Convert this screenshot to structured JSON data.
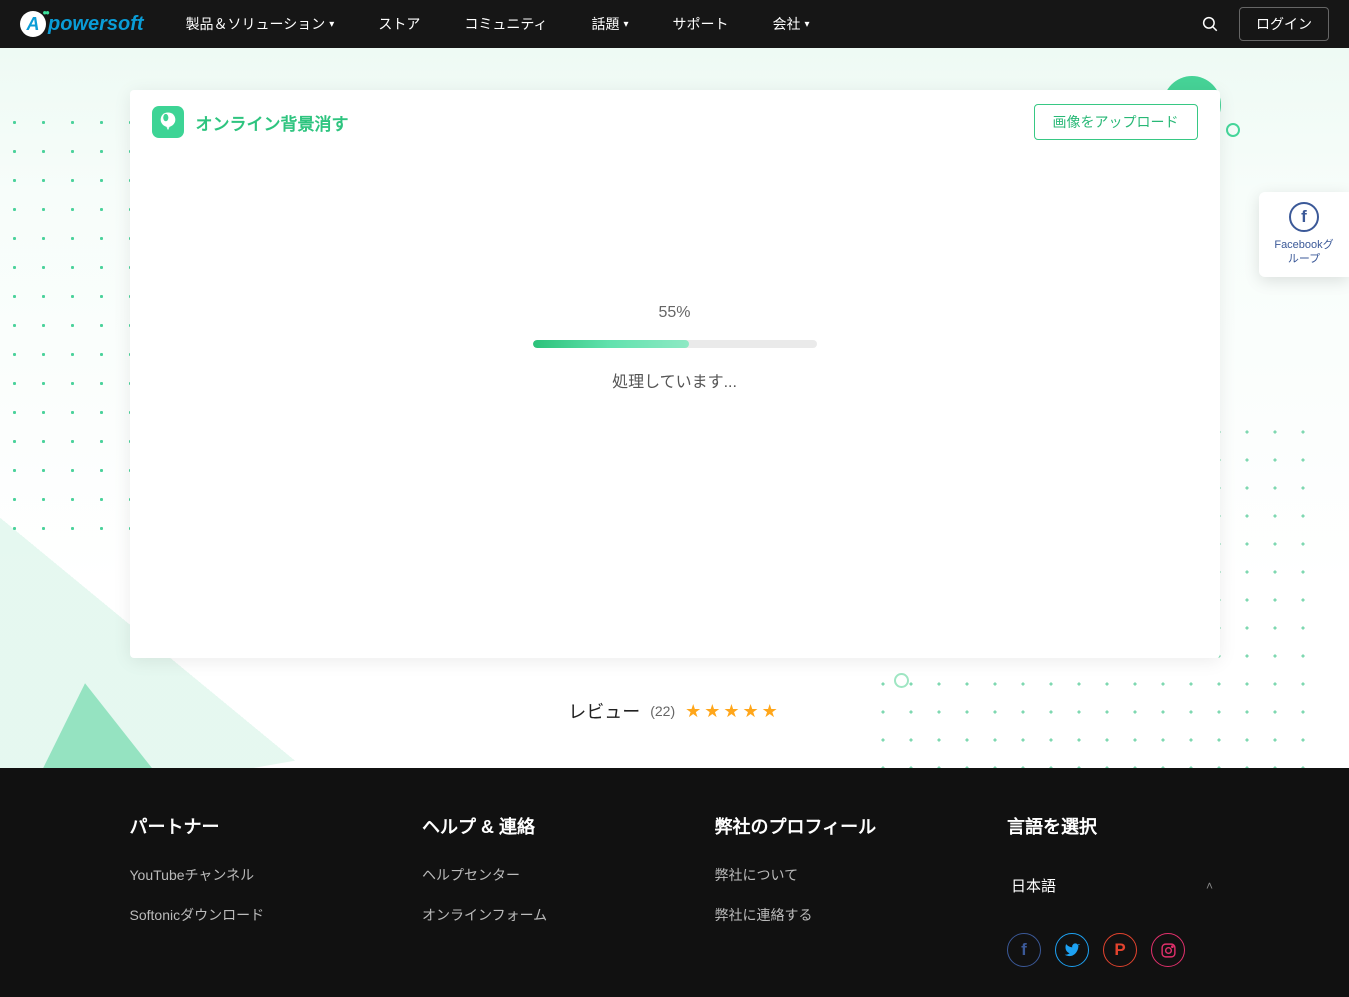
{
  "brand": {
    "letter": "A",
    "rest": "powersoft"
  },
  "nav": {
    "products": "製品＆ソリューション",
    "store": "ストア",
    "community": "コミュニティ",
    "topics": "話題",
    "support": "サポート",
    "company": "会社"
  },
  "login": "ログイン",
  "app": {
    "title": "オンライン背景消す",
    "upload": "画像をアップロード"
  },
  "progress": {
    "percent": "55%",
    "value": 55,
    "label": "処理しています..."
  },
  "review": {
    "label": "レビュー",
    "count": "(22)"
  },
  "fb_widget": "Facebookグループ",
  "footer": {
    "col1": {
      "title": "パートナー",
      "items": [
        "YouTubeチャンネル",
        "Softonicダウンロード"
      ]
    },
    "col2": {
      "title": "ヘルプ & 連絡",
      "items": [
        "ヘルプセンター",
        "オンラインフォーム"
      ]
    },
    "col3": {
      "title": "弊社のプロフィール",
      "items": [
        "弊社について",
        "弊社に連絡する"
      ]
    },
    "col4": {
      "title": "言語を選択",
      "lang": "日本語"
    }
  }
}
